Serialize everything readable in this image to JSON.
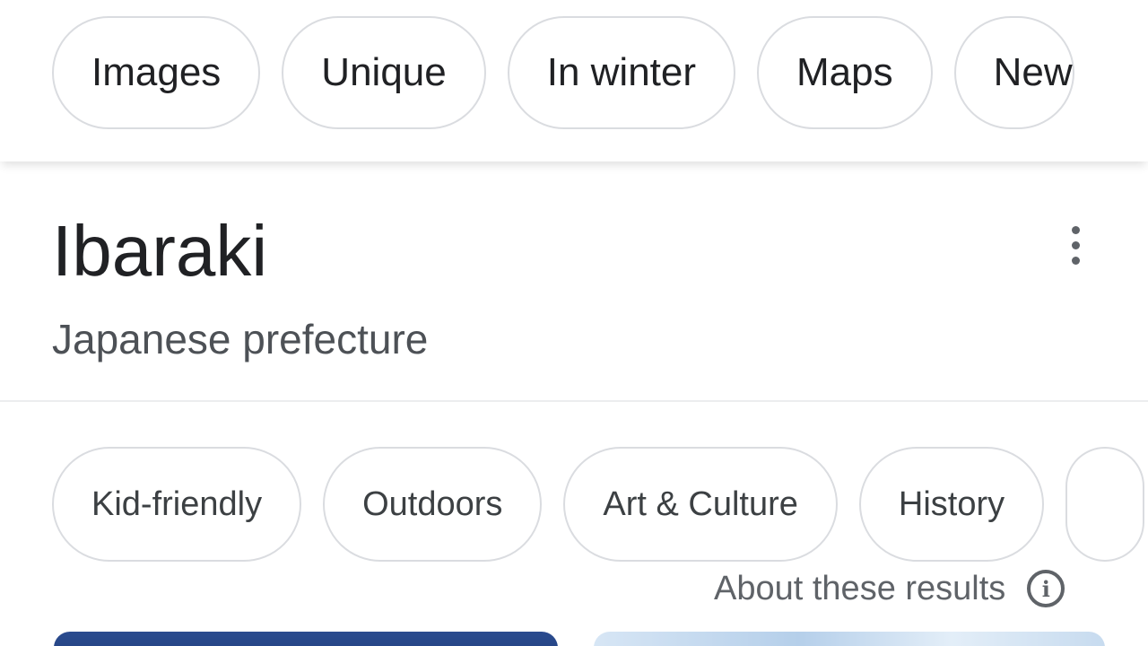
{
  "top_chips": [
    "Images",
    "Unique",
    "In winter",
    "Maps",
    "New"
  ],
  "entity": {
    "title": "Ibaraki",
    "subtitle": "Japanese prefecture"
  },
  "category_chips": [
    "Kid-friendly",
    "Outdoors",
    "Art & Culture",
    "History",
    ""
  ],
  "about": {
    "label": "About these results"
  },
  "icons": {
    "more": "more-vert-icon",
    "info": "info-icon"
  },
  "colors": {
    "chip_border": "#dadce0",
    "title": "#202124",
    "subtitle": "#4d5156",
    "secondary_text": "#5f6368",
    "card_1": "#2a4b8f",
    "card_2": "#c7dbef"
  }
}
